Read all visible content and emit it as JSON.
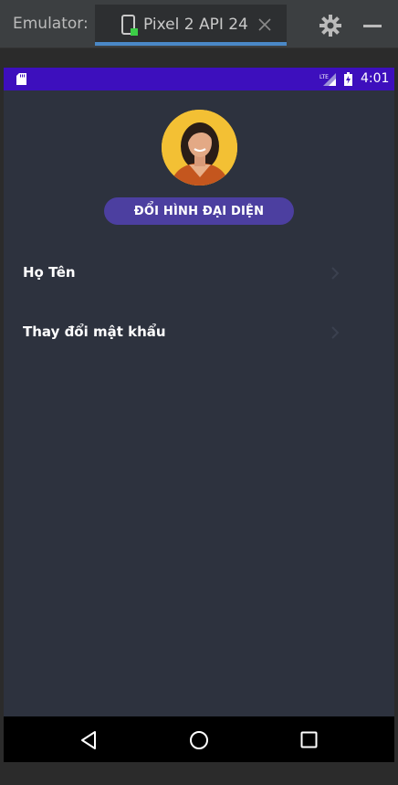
{
  "emulator": {
    "label": "Emulator:",
    "tab_label": "Pixel 2 API 24"
  },
  "status_bar": {
    "time": "4:01",
    "network_icon": "lte-signal-icon",
    "battery_icon": "battery-charging-icon",
    "color": "#3d0fbd"
  },
  "profile": {
    "change_avatar_label": "ĐỔI HÌNH ĐẠI DIỆN",
    "button_color": "#4c3fa0"
  },
  "menu": {
    "items": [
      {
        "label": "Họ Tên"
      },
      {
        "label": "Thay đổi mật khẩu"
      }
    ]
  },
  "theme": {
    "screen_background": "#2d323e",
    "accent": "#4a88c7"
  }
}
